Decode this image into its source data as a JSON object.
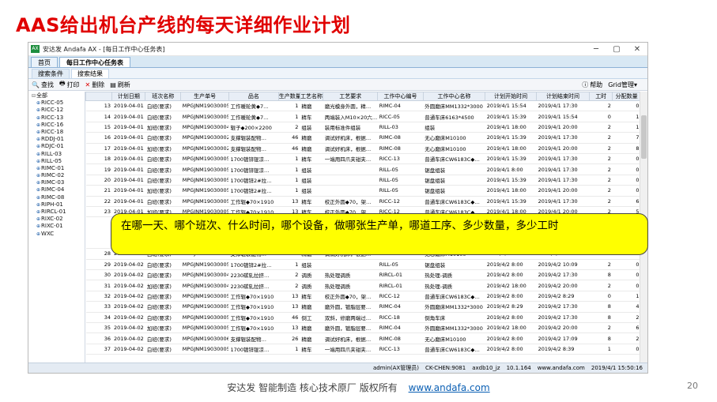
{
  "slide": {
    "title": "AAS给出机台产线的每天详细作业计划",
    "callout": "在哪一天、哪个班次、什么时间，哪个设备，做哪张生产单，哪道工序、多少数量，多少工时",
    "footer_text": "安达发 智能制造 核心技术原厂 版权所有",
    "footer_link": "www.andafa.com",
    "page_number": "20"
  },
  "window": {
    "app_icon": "AX",
    "title": "安达发 Andafa AX - [每日工作中心任务表]",
    "minimize_icon": "─",
    "maximize_icon": "▢",
    "close_icon": "✕"
  },
  "tabs": [
    "首页",
    "每日工作中心任务表"
  ],
  "subtabs": [
    "搜索条件",
    "搜索结果"
  ],
  "toolbar": {
    "search": "查找",
    "print": "打印",
    "delete": "删除",
    "refresh": "刷新",
    "help": "帮助",
    "grid_manage": "Grid管理"
  },
  "tree": [
    "全部",
    "RICC-05",
    "RICC-12",
    "RICC-13",
    "RICC-16",
    "RICC-18",
    "RDDJ-01",
    "RDJC-01",
    "RILL-03",
    "RILL-05",
    "RIMC-01",
    "RIMC-02",
    "RIMC-03",
    "RIMC-04",
    "RIMC-08",
    "RIPH-01",
    "RIRCL-01",
    "RIXC-02",
    "RIXC-01",
    "WXC"
  ],
  "grid": {
    "headers": [
      "",
      "计划日期",
      "班次名称",
      "生产单号",
      "品名",
      "生产数量",
      "工艺名称",
      "工艺要求",
      "工作中心编号",
      "工作中心名称",
      "计划开始时间",
      "计划结束时间",
      "工时",
      "分配数量"
    ],
    "rows_top": [
      [
        "13",
        "2019-04-01",
        "白班(要求)",
        "MPGJNM190300051",
        "工作暖轮黄◆7…",
        "1",
        "精磨",
        "磨光模身外圆，精…",
        "RIMC-04",
        "外圆磨床MM1332*3000",
        "2019/4/1 15:54",
        "2019/4/1 17:30",
        "2",
        "0"
      ],
      [
        "14",
        "2019-04-01",
        "白班(要求)",
        "MPGJNM190300051",
        "工作暖轮黄◆7…",
        "1",
        "精车",
        "两端装入M10×20六…",
        "RICC-05",
        "普通车床6163*4500",
        "2019/4/1 15:39",
        "2019/4/1 15:54",
        "0",
        "1"
      ],
      [
        "15",
        "2019-04-01",
        "加班(要求)",
        "MPGJNM190300042",
        "辊子◆200×2200",
        "2",
        "组装",
        "装用标准件组装",
        "RILL-03",
        "组装",
        "2019/4/1 18:00",
        "2019/4/1 20:00",
        "2",
        "1"
      ],
      [
        "16",
        "2019-04-01",
        "白班(要求)",
        "MPGJNM190300025",
        "支撑辊装配物…",
        "46",
        "精磨",
        "调试好机床，根据…",
        "RIMC-08",
        "无心磨床M10100",
        "2019/4/1 15:39",
        "2019/4/1 17:30",
        "2",
        "7"
      ],
      [
        "17",
        "2019-04-01",
        "加班(要求)",
        "MPGJNM190300025",
        "支撑辊装配物…",
        "46",
        "精磨",
        "调试好机床，根据…",
        "RIMC-08",
        "无心磨床M10100",
        "2019/4/1 18:00",
        "2019/4/1 20:00",
        "2",
        "8"
      ],
      [
        "18",
        "2019-04-01",
        "白班(要求)",
        "MPGJNM190300058",
        "1700镀锌锟凉…",
        "1",
        "精车",
        "一端用四爪夹钳夹…",
        "RICC-13",
        "普通车床CW6183C◆…",
        "2019/4/1 15:39",
        "2019/4/1 17:30",
        "2",
        "0"
      ],
      [
        "19",
        "2019-04-01",
        "白班(要求)",
        "MPGJNM190300059",
        "1700镀锌锟凉…",
        "1",
        "组装",
        "",
        "RILL-05",
        "锯盘组装",
        "2019/4/1 8:00",
        "2019/4/1 17:30",
        "2",
        "0"
      ],
      [
        "20",
        "2019-04-01",
        "白班(要求)",
        "MPGJNM190300059",
        "1700镀锌2#拉…",
        "1",
        "组装",
        "",
        "RILL-05",
        "锯盘组装",
        "2019/4/1 15:39",
        "2019/4/1 17:30",
        "2",
        "0"
      ],
      [
        "21",
        "2019-04-01",
        "加班(要求)",
        "MPGJNM190300059",
        "1700镀锌2#拉…",
        "1",
        "组装",
        "",
        "RILL-05",
        "锯盘组装",
        "2019/4/1 18:00",
        "2019/4/1 20:00",
        "2",
        "0"
      ],
      [
        "22",
        "2019-04-01",
        "白班(要求)",
        "MPGJNM190300052",
        "工作辊◆70×1910",
        "13",
        "精车",
        "校正外圆◆70，架…",
        "RICC-12",
        "普通车床CW6183C◆…",
        "2019/4/1 15:39",
        "2019/4/1 17:30",
        "2",
        "6"
      ],
      [
        "23",
        "2019-04-01",
        "加班(要求)",
        "MPGJNM190300052",
        "工作辊◆70×1910",
        "13",
        "精车",
        "校正外圆◆70，架…",
        "RICC-12",
        "普通车床CW6183C◆…",
        "2019/4/1 18:00",
        "2019/4/1 20:00",
        "2",
        "5"
      ]
    ],
    "rows_bottom": [
      [
        "28",
        "2019-04-02",
        "白班(要求)",
        "MPGJNM190300060",
        "支撑辊装配物…",
        "26",
        "精磨",
        "调试好机床，根据…",
        "RIMC-08",
        "无心磨床M10100",
        "2019/4/2 18:00",
        "2019/4/2 20:00",
        "2",
        "8"
      ],
      [
        "29",
        "2019-04-02",
        "白班(要求)",
        "MPGJNM190300059",
        "1700镀锌2#拉…",
        "1",
        "组装",
        "",
        "RILL-05",
        "锯盘组装",
        "2019/4/2 8:00",
        "2019/4/2 10:09",
        "2",
        "0"
      ],
      [
        "30",
        "2019-04-02",
        "白班(要求)",
        "MPGJNM190300047",
        "2230碳轧拉挤…",
        "2",
        "调质",
        "热处理调质",
        "RIRCL-01",
        "热处理-调质",
        "2019/4/2 8:00",
        "2019/4/2 17:30",
        "8",
        "0"
      ],
      [
        "31",
        "2019-04-02",
        "加班(要求)",
        "MPGJNM190300047",
        "2230碳轧拉挤…",
        "2",
        "调质",
        "热处理调质",
        "RIRCL-01",
        "热处理-调质",
        "2019/4/2 18:00",
        "2019/4/2 20:00",
        "2",
        "0"
      ],
      [
        "32",
        "2019-04-02",
        "白班(要求)",
        "MPGJNM190300052",
        "工作辊◆70×1910",
        "13",
        "精车",
        "校正外圆◆70，架…",
        "RICC-12",
        "普通车床CW6183C◆…",
        "2019/4/2 8:00",
        "2019/4/2 8:29",
        "0",
        "1"
      ],
      [
        "33",
        "2019-04-02",
        "白班(要求)",
        "MPGJNM190300052",
        "工作辊◆70×1910",
        "13",
        "精磨",
        "磨外圆，镀脂层要…",
        "RIMC-04",
        "外圆磨床MM1332*3000",
        "2019/4/2 8:29",
        "2019/4/2 17:30",
        "8",
        "4"
      ],
      [
        "34",
        "2019-04-02",
        "白班(要求)",
        "MPGJNM190300052",
        "工作辊◆70×1910",
        "46",
        "倒工",
        "双斜，修磨两端过…",
        "RICC-18",
        "倒角车床",
        "2019/4/2 8:00",
        "2019/4/2 17:30",
        "8",
        "2"
      ],
      [
        "35",
        "2019-04-02",
        "加班(要求)",
        "MPGJNM190300052",
        "工作辊◆70×1910",
        "13",
        "精磨",
        "磨外圆，镀脂层要…",
        "RIMC-04",
        "外圆磨床MM1332*3000",
        "2019/4/2 18:00",
        "2019/4/2 20:00",
        "2",
        "6"
      ],
      [
        "36",
        "2019-04-02",
        "白班(要求)",
        "MPGJNM190300060",
        "支撑辊装配物…",
        "26",
        "精磨",
        "调试好机床，根据…",
        "RIMC-08",
        "无心磨床M10100",
        "2019/4/2 8:00",
        "2019/4/2 17:09",
        "8",
        "2"
      ],
      [
        "37",
        "2019-04-02",
        "白班(要求)",
        "MPGJNM190300058",
        "1700镀锌锟凉…",
        "1",
        "精车",
        "一端用四爪夹钳夹…",
        "RICC-13",
        "普通车床CW6183C◆…",
        "2019/4/2 8:00",
        "2019/4/2 8:39",
        "1",
        "0"
      ]
    ]
  },
  "status": {
    "user": "admin(AX管理员)",
    "machine": "CK-CHEN:9081",
    "db": "axdb10_jz",
    "ip": "10.1.164",
    "site": "www.andafa.com",
    "time": "2019/4/1 15:50:16"
  }
}
